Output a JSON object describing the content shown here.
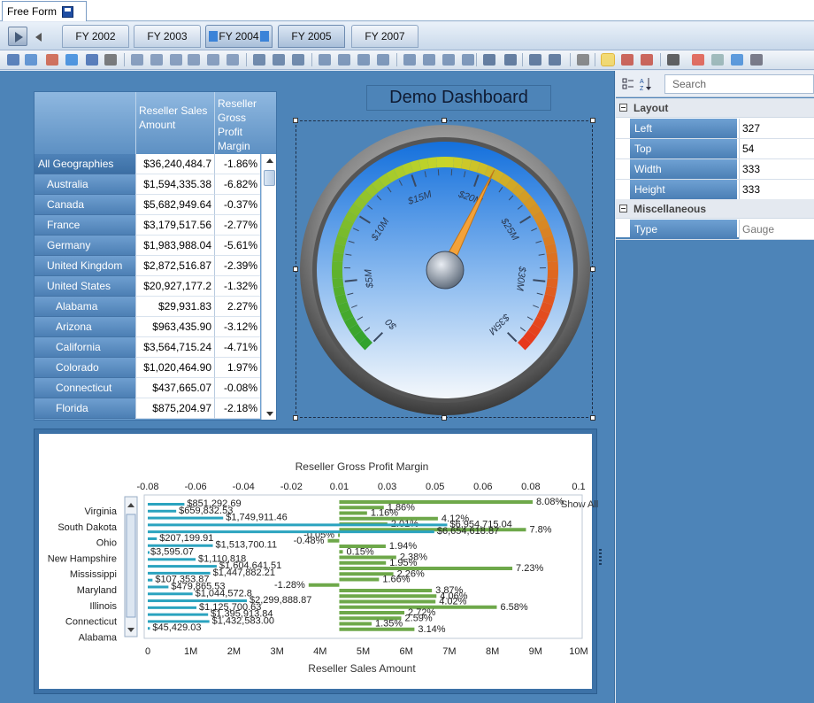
{
  "doc_tab": {
    "label": "Free Form"
  },
  "fy_tabs": [
    {
      "label": "FY 2002"
    },
    {
      "label": "FY 2003"
    },
    {
      "label": "FY 2004"
    },
    {
      "label": "FY 2005"
    },
    {
      "label": "FY 2007"
    }
  ],
  "grid": {
    "headers": [
      "Reseller Sales Amount",
      "Reseller Gross Profit Margin"
    ],
    "rows": [
      {
        "label": "All Geographies",
        "sales": "$36,240,484.7",
        "margin": "-1.86%"
      },
      {
        "label": "Australia",
        "sales": "$1,594,335.38",
        "margin": "-6.82%"
      },
      {
        "label": "Canada",
        "sales": "$5,682,949.64",
        "margin": "-0.37%"
      },
      {
        "label": "France",
        "sales": "$3,179,517.56",
        "margin": "-2.77%"
      },
      {
        "label": "Germany",
        "sales": "$1,983,988.04",
        "margin": "-5.61%"
      },
      {
        "label": "United Kingdom",
        "sales": "$2,872,516.87",
        "margin": "-2.39%"
      },
      {
        "label": "United States",
        "sales": "$20,927,177.2",
        "margin": "-1.32%"
      },
      {
        "label": "Alabama",
        "sales": "$29,931.83",
        "margin": "2.27%"
      },
      {
        "label": "Arizona",
        "sales": "$963,435.90",
        "margin": "-3.12%"
      },
      {
        "label": "California",
        "sales": "$3,564,715.24",
        "margin": "-4.71%"
      },
      {
        "label": "Colorado",
        "sales": "$1,020,464.90",
        "margin": "1.97%"
      },
      {
        "label": "Connecticut",
        "sales": "$437,665.07",
        "margin": "-0.08%"
      },
      {
        "label": "Florida",
        "sales": "$875,204.97",
        "margin": "-2.18%"
      }
    ]
  },
  "dashboard": {
    "title": "Demo Dashboard"
  },
  "gauge": {
    "tick_labels": [
      "$0",
      "$5M",
      "$10M",
      "$15M",
      "$20M",
      "$25M",
      "$30M",
      "$35M"
    ],
    "value_millions": 20.9,
    "max_millions": 35,
    "colors": {
      "low": "#2ea12e",
      "mid": "#c9d62a",
      "high": "#e8341c",
      "needle": "#f3a23a",
      "face": "#1f7ce0"
    }
  },
  "chart_data": {
    "type": "bar",
    "title": "Reseller Gross Profit Margin",
    "xlabel": "Reseller Sales Amount",
    "top_axis_ticks": [
      "-0.08",
      "-0.06",
      "-0.04",
      "-0.02",
      "0.01",
      "0.03",
      "0.05",
      "0.06",
      "0.08",
      "0.1"
    ],
    "bottom_axis_ticks": [
      "0",
      "1M",
      "2M",
      "3M",
      "4M",
      "5M",
      "6M",
      "7M",
      "8M",
      "9M",
      "10M"
    ],
    "categories": [
      "Virginia",
      "South Dakota",
      "Ohio",
      "New Hampshire",
      "Mississippi",
      "Maryland",
      "Illinois",
      "Connecticut",
      "Alabama"
    ],
    "legend_label": "Show All",
    "sales_labels": [
      "$851,292.69",
      "$659,832.53",
      "$1,749,911.46",
      "$6,954,715.04",
      "$6,654,618.87",
      "$207,199.91",
      "$1,513,700.11",
      "$3,595.07",
      "$1,110,818",
      "$1,604,641.51",
      "$1,447,882.21",
      "$107,353.87",
      "$479,865.53",
      "$1,044,572.8",
      "$2,299,888.87",
      "$1,125,700.63",
      "$1,395,913.84",
      "$1,432,583.00",
      "$45,429.03"
    ],
    "margin_labels": [
      "8.08%",
      "1.86%",
      "1.16%",
      "4.12%",
      "2.01%",
      "7.8%",
      "-0.05%",
      "-0.48%",
      "1.94%",
      "0.15%",
      "2.38%",
      "1.95%",
      "7.23%",
      "2.26%",
      "1.66%",
      "-1.28%",
      "3.87%",
      "4.06%",
      "4.02%",
      "6.58%",
      "2.72%",
      "2.59%",
      "1.35%",
      "3.14%"
    ],
    "sales_millions": [
      0.85,
      0.66,
      1.75,
      6.95,
      6.65,
      0.21,
      1.51,
      0.0,
      1.11,
      1.6,
      1.45,
      0.11,
      0.48,
      1.04,
      2.3,
      1.13,
      1.4,
      1.43,
      0.05
    ],
    "margin_values": [
      0.0808,
      0.0186,
      0.0116,
      0.0412,
      0.0201,
      0.078,
      -0.0005,
      -0.0048,
      0.0194,
      0.0015,
      0.0238,
      0.0195,
      0.0723,
      0.0226,
      0.0166,
      -0.0128,
      0.0387,
      0.0406,
      0.0402,
      0.0658,
      0.0272,
      0.0259,
      0.0135,
      0.0314
    ],
    "colors": {
      "margin_bar": "#6ea84a",
      "sales_bar": "#2aa3bf"
    }
  },
  "properties": {
    "search_placeholder": "Search",
    "groups": [
      {
        "label": "Layout",
        "rows": [
          {
            "name": "Left",
            "value": "327"
          },
          {
            "name": "Top",
            "value": "54"
          },
          {
            "name": "Width",
            "value": "333"
          },
          {
            "name": "Height",
            "value": "333"
          }
        ]
      },
      {
        "label": "Miscellaneous",
        "rows": [
          {
            "name": "Type",
            "value": "Gauge"
          }
        ]
      }
    ]
  }
}
